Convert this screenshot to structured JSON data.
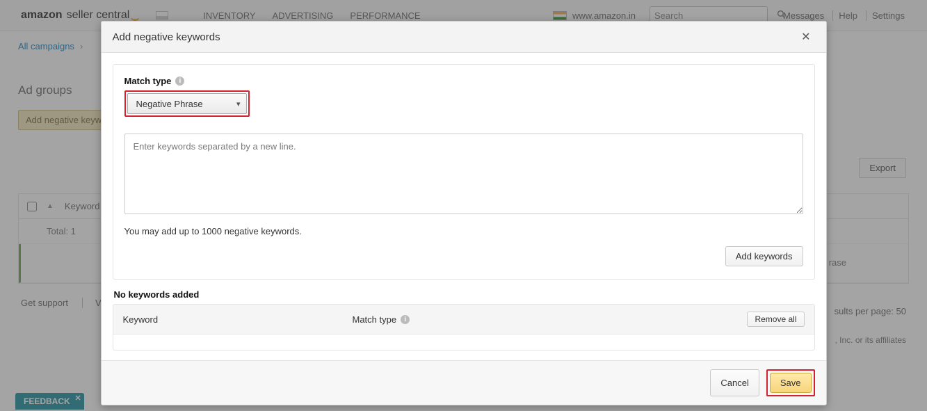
{
  "header": {
    "logo_amazon": "amazon",
    "logo_rest": "seller central",
    "nav": [
      "INVENTORY",
      "ADVERTISING",
      "PERFORMANCE"
    ],
    "locale": "www.amazon.in",
    "search_placeholder": "Search",
    "links": {
      "messages": "Messages",
      "help": "Help",
      "settings": "Settings"
    }
  },
  "breadcrumb": {
    "item0": "All campaigns"
  },
  "tabs": {
    "item0": "Ad groups"
  },
  "bg_buttons": {
    "add_negative_fragment": "Add negative keywo",
    "export": "Export"
  },
  "bg_table": {
    "col_keyword": "Keyword",
    "row_total": "Total: 1"
  },
  "bg_fragments": {
    "rase": "rase",
    "results_per_page": "sults per page: 50"
  },
  "footer": {
    "support": "Get support",
    "view_fragment": "View",
    "copyright_fragment": ", Inc. or its affiliates"
  },
  "feedback": {
    "label": "FEEDBACK"
  },
  "modal": {
    "title": "Add negative keywords",
    "match_type_label": "Match type",
    "match_type_value": "Negative Phrase",
    "textarea_placeholder": "Enter keywords separated by a new line.",
    "hint": "You may add up to 1000 negative keywords.",
    "add_keywords": "Add keywords",
    "no_keywords": "No keywords added",
    "table": {
      "col_keyword": "Keyword",
      "col_match_type": "Match type",
      "remove_all": "Remove all"
    },
    "cancel": "Cancel",
    "save": "Save"
  }
}
